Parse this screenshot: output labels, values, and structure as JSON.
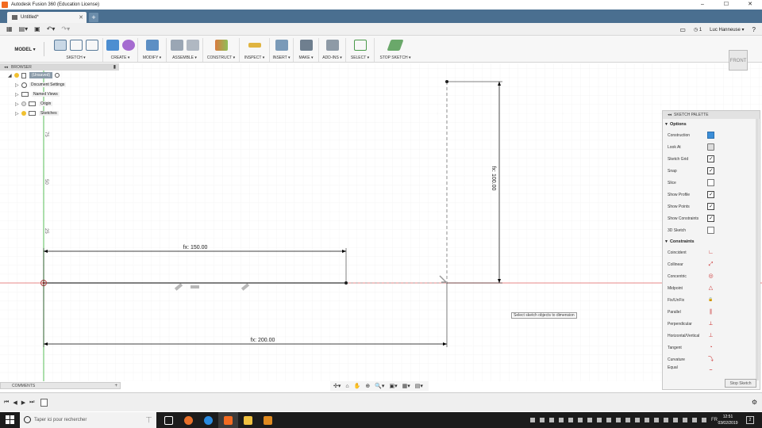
{
  "window": {
    "title": "Autodesk Fusion 360 (Education License)",
    "controls": [
      "–",
      "☐",
      "✕"
    ]
  },
  "tabs": {
    "active_doc": "Untitled*",
    "close": "✕",
    "add": "+"
  },
  "quickbar": {
    "clock_count": "1",
    "user": "Luc Hanneuse ▾",
    "help": "?"
  },
  "toolbar": {
    "workspace": "MODEL ▾",
    "groups": [
      "SKETCH ▾",
      "CREATE ▾",
      "MODIFY ▾",
      "ASSEMBLE ▾",
      "CONSTRUCT ▾",
      "INSPECT ▾",
      "INSERT ▾",
      "MAKE ▾",
      "ADD-INS ▾",
      "SELECT ▾",
      "STOP SKETCH ▾"
    ]
  },
  "browser": {
    "header": "BROWSER",
    "root": "(Unsaved)",
    "items": [
      "Document Settings",
      "Named Views",
      "Origin",
      "Sketches"
    ]
  },
  "sketch": {
    "dim_top": "fx: 150.00",
    "dim_bottom": "fx: 200.00",
    "dim_vertical": "fx: 100.00",
    "ruler_ticks": [
      "75",
      "50",
      "25"
    ]
  },
  "viewcube": {
    "face": "FRONT"
  },
  "palette": {
    "header": "SKETCH PALETTE",
    "options_title": "Options",
    "options": [
      {
        "label": "Construction",
        "state": "button"
      },
      {
        "label": "Look At",
        "state": "icon"
      },
      {
        "label": "Sketch Grid",
        "state": "checked"
      },
      {
        "label": "Snap",
        "state": "checked"
      },
      {
        "label": "Slice",
        "state": "unchecked"
      },
      {
        "label": "Show Profile",
        "state": "checked"
      },
      {
        "label": "Show Points",
        "state": "checked"
      },
      {
        "label": "Show Constraints",
        "state": "checked"
      },
      {
        "label": "3D Sketch",
        "state": "unchecked"
      }
    ],
    "constraints_title": "Constraints",
    "constraints": [
      {
        "label": "Coincident",
        "icon": "∟"
      },
      {
        "label": "Collinear",
        "icon": "⤢"
      },
      {
        "label": "Concentric",
        "icon": "◎"
      },
      {
        "label": "Midpoint",
        "icon": "△"
      },
      {
        "label": "Fix/UnFix",
        "icon": "🔒"
      },
      {
        "label": "Parallel",
        "icon": "∥"
      },
      {
        "label": "Perpendicular",
        "icon": "⟂"
      },
      {
        "label": "Horizontal/Vertical",
        "icon": "⊥"
      },
      {
        "label": "Tangent",
        "icon": "◔"
      },
      {
        "label": "Curvature",
        "icon": "⤵"
      },
      {
        "label": "Equal",
        "icon": "="
      }
    ],
    "stop_button": "Stop Sketch"
  },
  "tooltip": "Select sketch objects to dimension",
  "comments": {
    "label": "COMMENTS",
    "add": "+"
  },
  "navbar": {
    "icons": [
      "✣▾",
      "⌂",
      "✋",
      "⊕",
      "🔍▾",
      "▣▾",
      "▦▾",
      "▤▾"
    ]
  },
  "timeline": {
    "controls": [
      "⏮",
      "◀",
      "▶",
      "⏭"
    ],
    "settings": "⚙"
  },
  "taskbar": {
    "search_placeholder": "Taper ici pour rechercher",
    "time": "12:51",
    "date": "03/02/2019",
    "notifications": "2",
    "lang": "FR"
  },
  "colors": {
    "tabbar": "#4a6f90",
    "x_axis": "#e06060",
    "y_axis": "#2fb02f",
    "sketch_line": "#000000",
    "accent_blue": "#3b8ed8"
  }
}
